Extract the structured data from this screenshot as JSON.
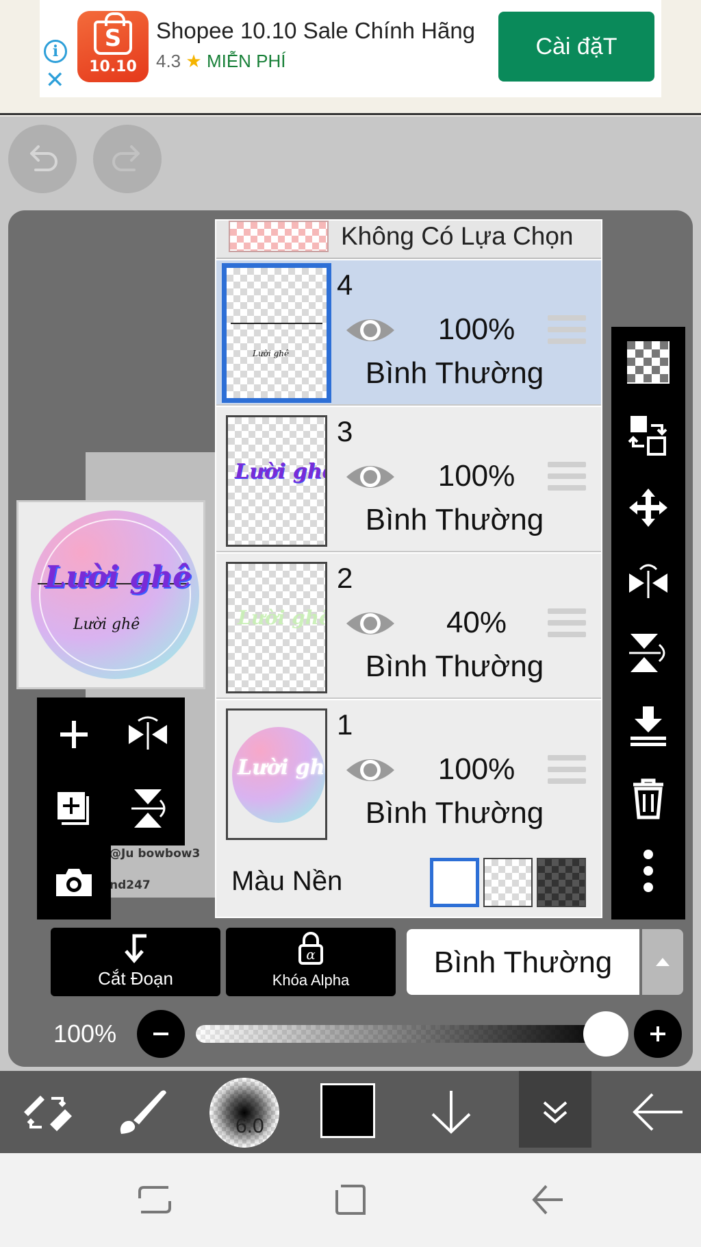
{
  "ad": {
    "info_icon": "i",
    "close_icon": "✕",
    "logo_letter": "S",
    "logo_number": "10.10",
    "title": "Shopee 10.10 Sale Chính Hãng",
    "rating": "4.3",
    "star": "★",
    "price": "MIỄN PHÍ",
    "install_label": "Cài đặT"
  },
  "canvas": {
    "thumb_title": "Lười ghê",
    "thumb_subtitle": "Lười ghê",
    "thumb_small": "@Ju bowbow3\nnd247",
    "text1": "@Ju bowbow3",
    "text2": "nd247"
  },
  "layers_panel": {
    "no_selection": "Không Có Lựa Chọn",
    "layers": [
      {
        "number": "4",
        "opacity": "100%",
        "mode": "Bình Thường",
        "selected": true
      },
      {
        "number": "3",
        "opacity": "100%",
        "mode": "Bình Thường",
        "thumb_text": "Lười ghê"
      },
      {
        "number": "2",
        "opacity": "40%",
        "mode": "Bình Thường",
        "thumb_text": "Lười ghê"
      },
      {
        "number": "1",
        "opacity": "100%",
        "mode": "Bình Thường",
        "thumb_text": "Lười ghê"
      }
    ],
    "layer4_thumb_text": "Lười ghê",
    "background_label": "Màu Nền"
  },
  "actions": {
    "clipping_label": "Cắt Đoạn",
    "alpha_lock_label": "Khóa Alpha",
    "blend_mode": "Bình Thường"
  },
  "opacity": {
    "label": "100%",
    "value_fraction": 1.0
  },
  "bottom_bar": {
    "brush_size": "6.0",
    "color": "#000000"
  },
  "colors": {
    "accent_blue": "#2d6fd6",
    "install_green": "#0a8a5a",
    "selected_layer_bg": "#c9d7ec"
  }
}
